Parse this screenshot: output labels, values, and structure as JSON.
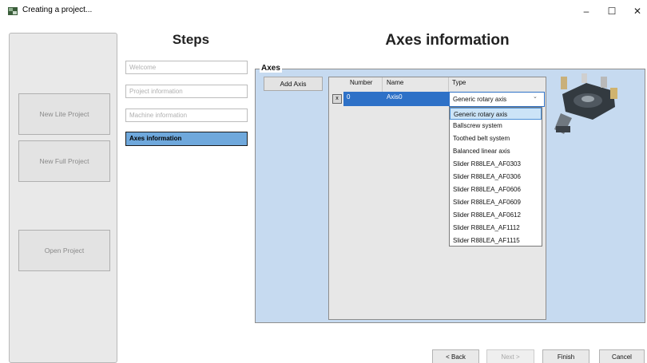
{
  "window": {
    "title": "Creating a project...",
    "minimize_glyph": "–",
    "maximize_glyph": "☐",
    "close_glyph": "✕"
  },
  "sidebar": {
    "buttons": [
      "New Lite Project",
      "New Full Project",
      "Open Project"
    ]
  },
  "steps": {
    "title": "Steps",
    "items": [
      "Welcome",
      "Project information",
      "Machine information",
      "Axes information"
    ],
    "active_index": 3
  },
  "main": {
    "heading": "Axes information",
    "group_label": "Axes",
    "add_axis_label": "Add Axis",
    "table": {
      "columns": [
        "Number",
        "Name",
        "Type"
      ],
      "rows": [
        {
          "delete_label": "x",
          "number": "0",
          "name": "Axis0",
          "type": "Generic rotary axis"
        }
      ]
    },
    "type_options": [
      "Generic rotary axis",
      "Ballscrew system",
      "Toothed belt system",
      "Balanced linear axis",
      "Slider R88LEA_AF0303",
      "Slider R88LEA_AF0306",
      "Slider R88LEA_AF0606",
      "Slider R88LEA_AF0609",
      "Slider R88LEA_AF0612",
      "Slider R88LEA_AF1112",
      "Slider R88LEA_AF1115"
    ],
    "selected_option_index": 0
  },
  "footer": {
    "back_label": "< Back",
    "next_label": "Next >",
    "finish_label": "Finish",
    "cancel_label": "Cancel"
  },
  "icons": {
    "app": "app-icon",
    "dropdown": "chevron-down-icon",
    "machine": "rotary-table-icon"
  },
  "colors": {
    "active_step": "#6fa8dc",
    "group_background": "#c6daf0",
    "selected_row": "#2e71c7",
    "option_highlight": "#cce4f7"
  }
}
